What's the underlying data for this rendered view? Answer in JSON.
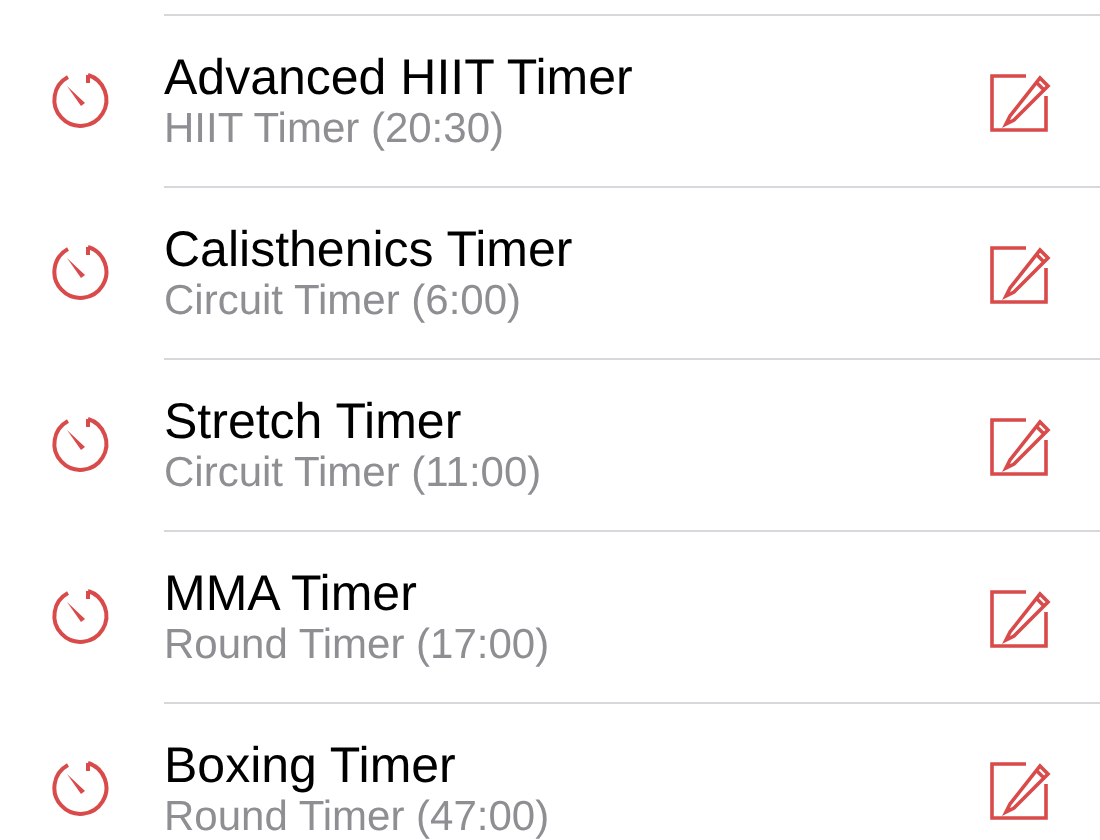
{
  "timers": [
    {
      "title": "Advanced HIIT Timer",
      "subtitle": "HIIT Timer (20:30)"
    },
    {
      "title": "Calisthenics Timer",
      "subtitle": "Circuit Timer (6:00)"
    },
    {
      "title": "Stretch Timer",
      "subtitle": "Circuit Timer (11:00)"
    },
    {
      "title": "MMA Timer",
      "subtitle": "Round Timer (17:00)"
    },
    {
      "title": "Boxing Timer",
      "subtitle": "Round Timer (47:00)"
    }
  ]
}
